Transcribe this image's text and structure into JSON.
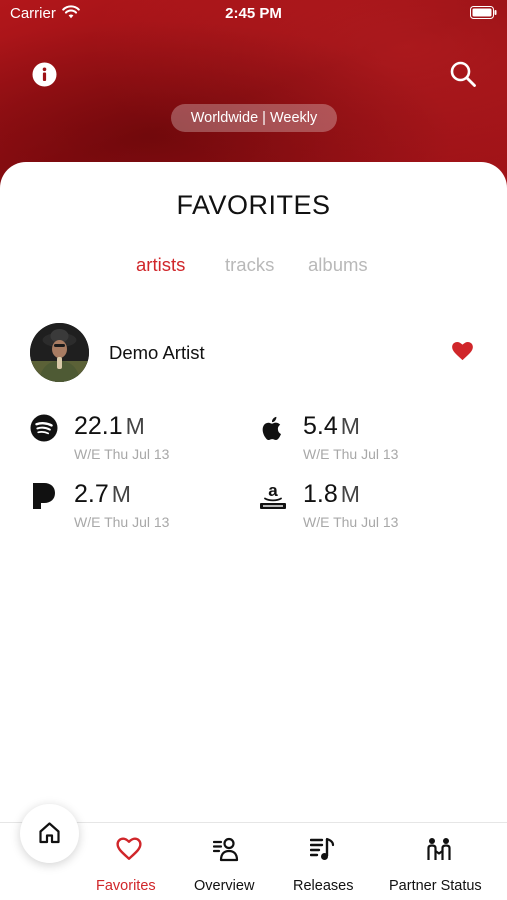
{
  "status_bar": {
    "carrier": "Carrier",
    "time": "2:45 PM"
  },
  "header": {
    "region_filter": "Worldwide | Weekly"
  },
  "page": {
    "title": "FAVORITES"
  },
  "tabs": [
    {
      "label": "artists",
      "active": true
    },
    {
      "label": "tracks",
      "active": false
    },
    {
      "label": "albums",
      "active": false
    }
  ],
  "artist": {
    "name": "Demo Artist",
    "favorited": true,
    "stats": [
      {
        "service": "spotify-icon",
        "value": "22.1",
        "unit": "M",
        "date": "W/E Thu Jul 13"
      },
      {
        "service": "apple-music-icon",
        "value": "5.4",
        "unit": "M",
        "date": "W/E Thu Jul 13"
      },
      {
        "service": "pandora-icon",
        "value": "2.7",
        "unit": "M",
        "date": "W/E Thu Jul 13"
      },
      {
        "service": "amazon-music-icon",
        "value": "1.8",
        "unit": "M",
        "date": "W/E Thu Jul 13"
      }
    ]
  },
  "nav": [
    {
      "label": "Favorites",
      "icon": "heart-icon",
      "active": true
    },
    {
      "label": "Overview",
      "icon": "person-list-icon",
      "active": false
    },
    {
      "label": "Releases",
      "icon": "music-list-icon",
      "active": false
    },
    {
      "label": "Partner Status",
      "icon": "partners-icon",
      "active": false
    }
  ],
  "colors": {
    "accent": "#d0262a",
    "header_red": "#a51419"
  }
}
